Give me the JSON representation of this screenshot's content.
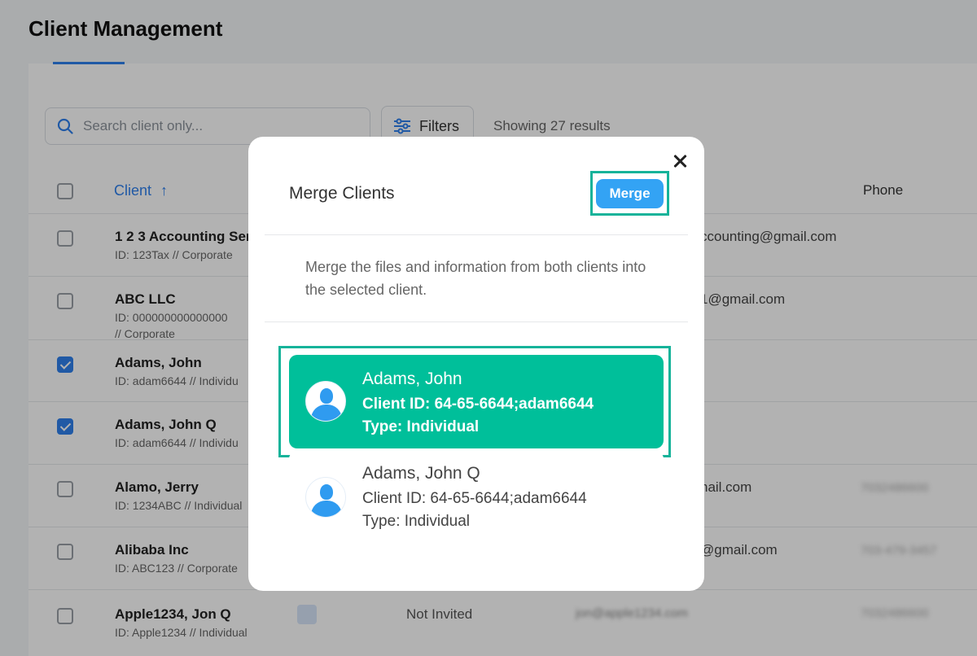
{
  "page": {
    "title": "Client Management",
    "search_placeholder": "Search client only...",
    "filters_label": "Filters",
    "results_text": "Showing 27 results",
    "columns": {
      "client": "Client",
      "phone": "Phone"
    }
  },
  "rows": [
    {
      "name": "1 2 3 Accounting Ser",
      "sub": "ID: 123Tax // Corporate",
      "email": "ccounting@gmail.com",
      "phone": "",
      "checked": false
    },
    {
      "name": "ABC LLC",
      "sub": "ID: 000000000000000",
      "sub2": "// Corporate",
      "email": "1@gmail.com",
      "phone": "",
      "checked": false
    },
    {
      "name": "Adams, John",
      "sub": "ID: adam6644 // Individu",
      "email": "",
      "phone": "",
      "checked": true
    },
    {
      "name": "Adams, John Q",
      "sub": "ID: adam6644 // Individu",
      "email": "",
      "phone": "",
      "checked": true
    },
    {
      "name": "Alamo, Jerry",
      "sub": "ID: 1234ABC // Individual",
      "email": "nail.com",
      "phone": "7032486600",
      "checked": false
    },
    {
      "name": "Alibaba Inc",
      "sub": "ID: ABC123 // Corporate",
      "email": "@gmail.com",
      "phone": "703-479-3457",
      "checked": false
    },
    {
      "name": "Apple1234, Jon Q",
      "sub": "ID: Apple1234 // Individual",
      "status": "Not Invited",
      "email_blur": "jon@apple1234.com",
      "phone": "7032486600",
      "checked": false
    }
  ],
  "modal": {
    "title": "Merge Clients",
    "merge_label": "Merge",
    "description": "Merge the files and information from both clients into the selected client.",
    "clients": [
      {
        "name": "Adams, John",
        "client_id": "Client ID: 64-65-6644;adam6644",
        "type": "Type: Individual",
        "selected": true
      },
      {
        "name": "Adams, John Q",
        "client_id": "Client ID: 64-65-6644;adam6644",
        "type": "Type: Individual",
        "selected": false
      }
    ]
  },
  "colors": {
    "accent_blue": "#2f80ed",
    "merge_button": "#33a3f4",
    "selected_green": "#00bf9a",
    "highlight_outline": "#16b39a"
  }
}
